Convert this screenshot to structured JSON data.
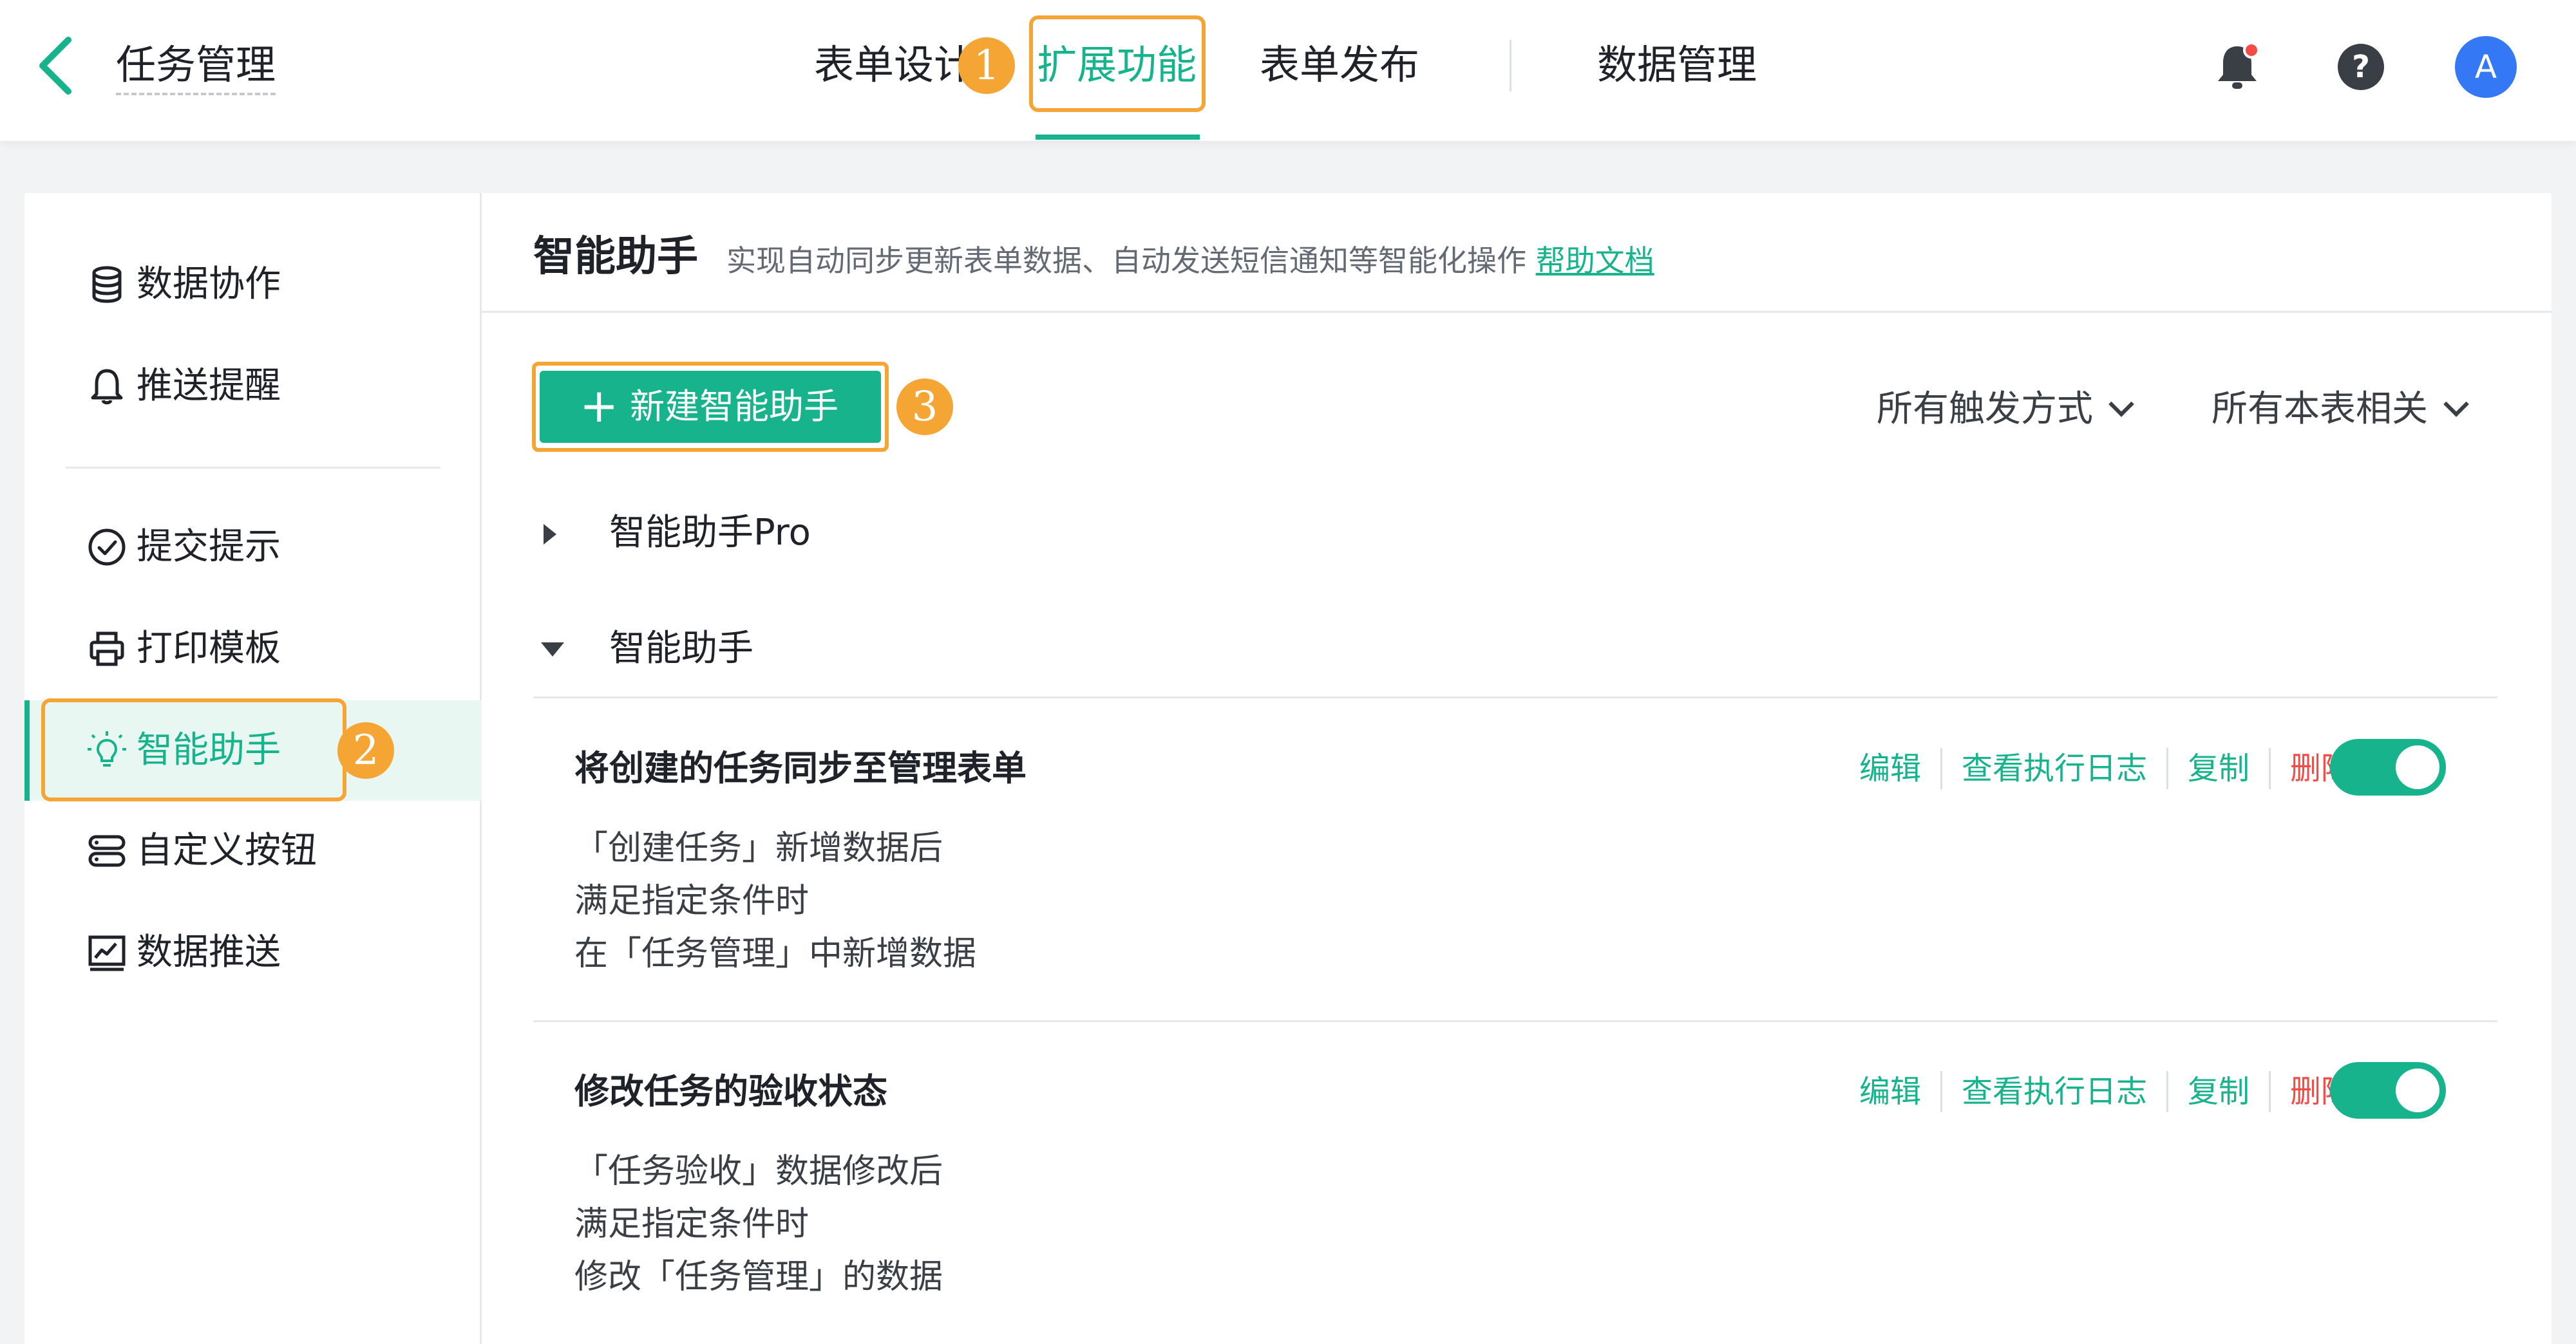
{
  "header": {
    "title": "任务管理",
    "tabs": [
      {
        "label": "表单设计"
      },
      {
        "label": "扩展功能"
      },
      {
        "label": "表单发布"
      },
      {
        "label": "数据管理"
      }
    ],
    "active_tab": "扩展功能",
    "avatar_letter": "A",
    "annotation_1": "1"
  },
  "sidebar": {
    "items": [
      {
        "label": "数据协作",
        "icon": "database-icon"
      },
      {
        "label": "推送提醒",
        "icon": "bell-icon"
      },
      {
        "label": "提交提示",
        "icon": "check-circle-icon"
      },
      {
        "label": "打印模板",
        "icon": "printer-icon"
      },
      {
        "label": "智能助手",
        "icon": "lightbulb-icon"
      },
      {
        "label": "自定义按钮",
        "icon": "custom-button-icon"
      },
      {
        "label": "数据推送",
        "icon": "chart-icon"
      }
    ],
    "active_item": "智能助手",
    "annotation_2": "2"
  },
  "main": {
    "title": "智能助手",
    "description": "实现自动同步更新表单数据、自动发送短信通知等智能化操作",
    "help_link": "帮助文档",
    "new_button": "新建智能助手",
    "annotation_3": "3",
    "filters": [
      {
        "label": "所有触发方式"
      },
      {
        "label": "所有本表相关"
      }
    ],
    "groups": [
      {
        "label": "智能助手Pro",
        "expanded": false
      },
      {
        "label": "智能助手",
        "expanded": true
      }
    ],
    "actions": {
      "edit": "编辑",
      "log": "查看执行日志",
      "copy": "复制",
      "delete": "删除"
    },
    "cards": [
      {
        "title": "将创建的任务同步至管理表单",
        "lines": [
          "「创建任务」新增数据后",
          "满足指定条件时",
          "在「任务管理」中新增数据"
        ],
        "enabled": true
      },
      {
        "title": "修改任务的验收状态",
        "lines": [
          "「任务验收」数据修改后",
          "满足指定条件时",
          "修改「任务管理」的数据"
        ],
        "enabled": true
      }
    ]
  },
  "colors": {
    "accent": "#17b38d",
    "highlight": "#f5a534",
    "danger": "#f54a45",
    "avatar": "#3478f6"
  }
}
